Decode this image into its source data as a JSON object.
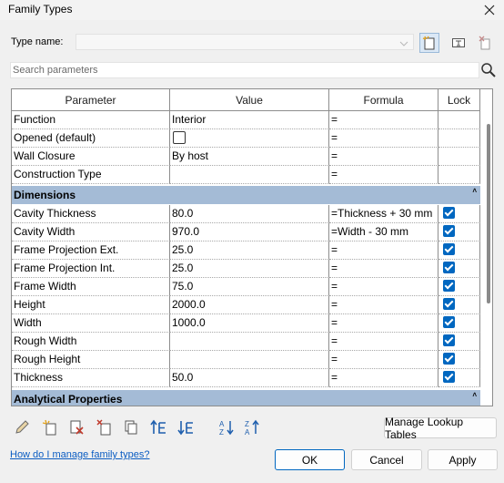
{
  "window": {
    "title": "Family Types"
  },
  "type_name": {
    "label": "Type name:",
    "value": ""
  },
  "search": {
    "placeholder": "Search parameters"
  },
  "grid": {
    "columns": [
      "Parameter",
      "Value",
      "Formula",
      "Lock"
    ],
    "rows_top": [
      {
        "parameter": "Function",
        "value": "Interior",
        "formula": "=",
        "lock": null
      },
      {
        "parameter": "Opened (default)",
        "value_checkbox": false,
        "formula": "=",
        "lock": null
      },
      {
        "parameter": "Wall Closure",
        "value": "By host",
        "formula": "=",
        "lock": null
      },
      {
        "parameter": "Construction Type",
        "value": "",
        "formula": "=",
        "lock": null
      }
    ],
    "group_dimensions": "Dimensions",
    "rows_dimensions": [
      {
        "parameter": "Cavity Thickness",
        "value": "80.0",
        "formula": "=Thickness + 30 mm",
        "lock": true
      },
      {
        "parameter": "Cavity Width",
        "value": "970.0",
        "formula": "=Width - 30 mm",
        "lock": true
      },
      {
        "parameter": "Frame Projection Ext.",
        "value": "25.0",
        "formula": "=",
        "lock": true
      },
      {
        "parameter": "Frame Projection Int.",
        "value": "25.0",
        "formula": "=",
        "lock": true
      },
      {
        "parameter": "Frame Width",
        "value": "75.0",
        "formula": "=",
        "lock": true
      },
      {
        "parameter": "Height",
        "value": "2000.0",
        "formula": "=",
        "lock": true
      },
      {
        "parameter": "Width",
        "value": "1000.0",
        "formula": "=",
        "lock": true
      },
      {
        "parameter": "Rough Width",
        "value": "",
        "formula": "=",
        "lock": true
      },
      {
        "parameter": "Rough Height",
        "value": "",
        "formula": "=",
        "lock": true
      },
      {
        "parameter": "Thickness",
        "value": "50.0",
        "formula": "=",
        "lock": true
      }
    ],
    "group_analytical": "Analytical Properties",
    "collapse_glyph": "˄"
  },
  "toolbar_icons": [
    "edit-parameter-icon",
    "new-parameter-icon",
    "delete-parameter-icon",
    "remove-parameter-icon",
    "copy-parameter-icon",
    "move-up-icon",
    "move-down-icon",
    "sort-ascending-icon",
    "sort-descending-icon"
  ],
  "buttons": {
    "manage_lookup": "Manage Lookup Tables",
    "ok": "OK",
    "cancel": "Cancel",
    "apply": "Apply"
  },
  "help_link": "How do I manage family types?",
  "colors": {
    "group_header": "#a4bbd6",
    "checkbox_on": "#0067c0",
    "link": "#0a5cc2",
    "ok_border": "#0067c0"
  }
}
